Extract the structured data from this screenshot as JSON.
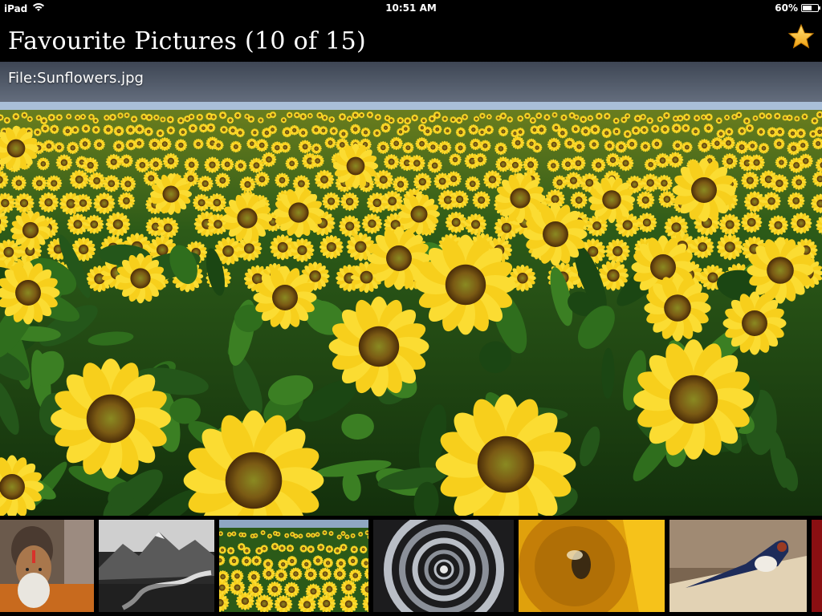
{
  "status_bar": {
    "device": "iPad",
    "time": "10:51 AM",
    "battery_percent": "60%",
    "battery_level": 0.6
  },
  "nav": {
    "title": "Favourite Pictures (10 of 15)",
    "favourite_icon": "star-icon"
  },
  "picture": {
    "caption": "File:Sunflowers.jpg"
  },
  "thumbnails": [
    {
      "subject": "portrait",
      "selected": false
    },
    {
      "subject": "mountains",
      "selected": false
    },
    {
      "subject": "sunflowers",
      "selected": true
    },
    {
      "subject": "spiral-staircase",
      "selected": false
    },
    {
      "subject": "bee-on-sunflower",
      "selected": false
    },
    {
      "subject": "swallow",
      "selected": false
    }
  ],
  "colors": {
    "star": "#f6b21c",
    "sky": "#4b5563",
    "sea": "#a7bdd6",
    "petal": "#f7d11e",
    "leaf": "#2e6b1c"
  }
}
